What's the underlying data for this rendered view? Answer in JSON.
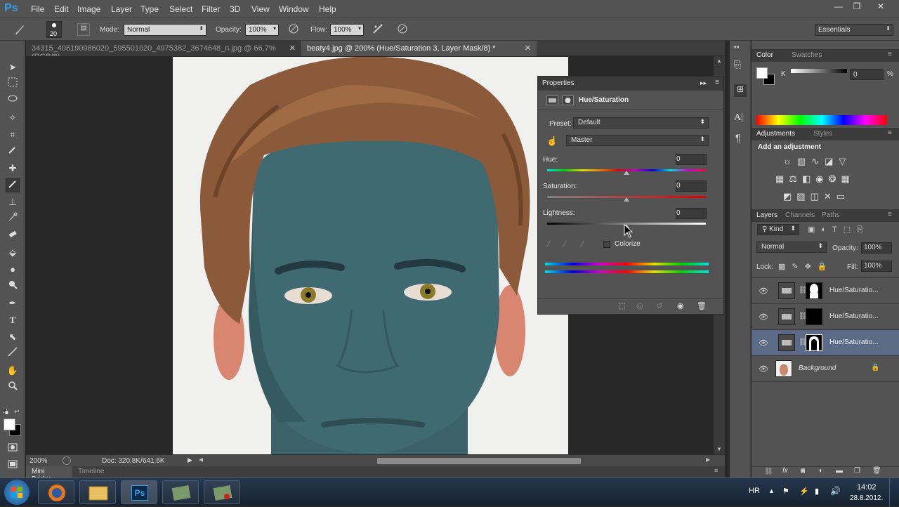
{
  "app": {
    "logo": "Ps"
  },
  "menu": [
    "File",
    "Edit",
    "Image",
    "Layer",
    "Type",
    "Select",
    "Filter",
    "3D",
    "View",
    "Window",
    "Help"
  ],
  "window_controls": [
    "—",
    "❐",
    "✕"
  ],
  "options": {
    "brush_size": "20",
    "mode_label": "Mode:",
    "mode_value": "Normal",
    "opacity_label": "Opacity:",
    "opacity_value": "100%",
    "flow_label": "Flow:",
    "flow_value": "100%",
    "workspace": "Essentials"
  },
  "tabs": [
    {
      "label": "34315_406190986020_595501020_4975382_3674648_n.jpg @ 66,7% (RGB/8)",
      "close": "✕",
      "active": false
    },
    {
      "label": "beaty4.jpg @ 200% (Hue/Saturation 3, Layer Mask/8) *",
      "close": "✕",
      "active": true
    }
  ],
  "status": {
    "zoom": "200%",
    "doc": "Doc: 320,8K/641,6K"
  },
  "bottom_tabs": [
    "Mini Bridge",
    "Timeline"
  ],
  "properties": {
    "title": "Properties",
    "adjustment": "Hue/Saturation",
    "preset_label": "Preset:",
    "preset_value": "Default",
    "channel_value": "Master",
    "hue_label": "Hue:",
    "hue_value": "0",
    "saturation_label": "Saturation:",
    "saturation_value": "0",
    "lightness_label": "Lightness:",
    "lightness_value": "0",
    "colorize_label": "Colorize",
    "hue_level": 0.5,
    "saturation_level": 0.5,
    "lightness_level": 0.5
  },
  "color_panel": {
    "tabs": [
      "Color",
      "Swatches"
    ],
    "k_label": "K",
    "k_value": "0",
    "unit": "%"
  },
  "adjustments_panel": {
    "tabs": [
      "Adjustments",
      "Styles"
    ],
    "heading": "Add an adjustment"
  },
  "layers_panel": {
    "tabs": [
      "Layers",
      "Channels",
      "Paths"
    ],
    "filter_kind": "Kind",
    "blend_mode": "Normal",
    "opacity_label": "Opacity:",
    "opacity_value": "100%",
    "lock_label": "Lock:",
    "fill_label": "Fill:",
    "fill_value": "100%",
    "layers": [
      {
        "name": "Hue/Saturatio...",
        "selected": false
      },
      {
        "name": "Hue/Saturatio...",
        "selected": false
      },
      {
        "name": "Hue/Saturatio...",
        "selected": true
      },
      {
        "name": "Background",
        "selected": false
      }
    ]
  },
  "taskbar": {
    "lang": "HR",
    "time": "14:02",
    "date": "28.8.2012."
  },
  "colors": {
    "ui_bg": "#535353",
    "panel_dark": "#3b3b3b",
    "selection": "#5b6a87",
    "ps_blue": "#3aa0e8",
    "skin_teal": "#3f6a72"
  }
}
